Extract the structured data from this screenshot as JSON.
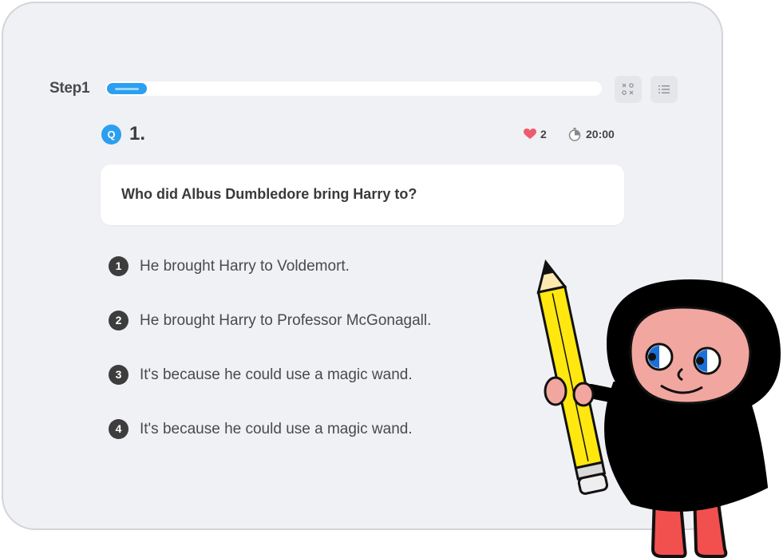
{
  "header": {
    "step_label": "Step1",
    "progress": 0.08
  },
  "toolbar": {
    "grid_icon": "grid-icon",
    "list_icon": "list-icon"
  },
  "question": {
    "badge": "Q",
    "number": "1.",
    "text": "Who did Albus Dumbledore bring Harry to?",
    "lives": "2",
    "timer": "20:00"
  },
  "answers": [
    {
      "num": "1",
      "text": "He brought Harry to Voldemort."
    },
    {
      "num": "2",
      "text": "He brought Harry to Professor McGonagall."
    },
    {
      "num": "3",
      "text": "It's because he could use a magic wand."
    },
    {
      "num": "4",
      "text": "It's because he could use a magic wand."
    }
  ],
  "colors": {
    "accent": "#2b9ff0",
    "heart": "#f05a6e",
    "panel_bg": "#eff1f5"
  }
}
